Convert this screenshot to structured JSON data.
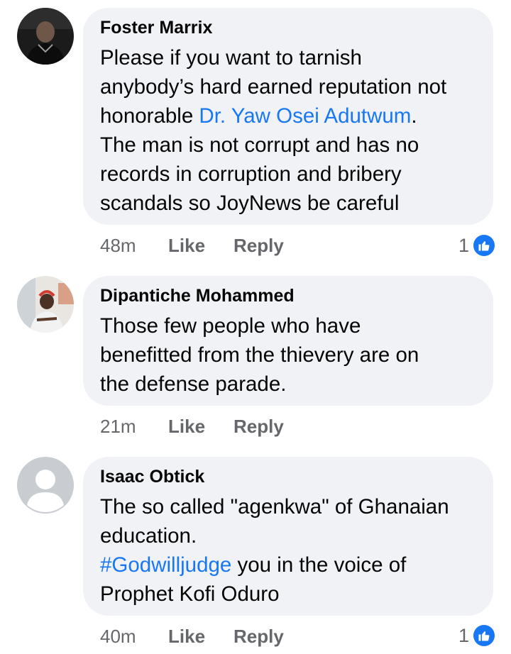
{
  "comments": [
    {
      "author": "Foster Marrix",
      "text_lines": [
        "Please if you want to tarnish",
        "anybody’s hard earned reputation not",
        "honorable ",
        "The man is not corrupt and has no",
        "records in corruption and bribery",
        "scandals so JoyNews be careful"
      ],
      "mention": "Dr. Yaw Osei Adutwum",
      "mention_suffix": ".",
      "time": "48m",
      "like_label": "Like",
      "reply_label": "Reply",
      "reaction_count": "1",
      "reaction_icon": "thumbs-up-icon"
    },
    {
      "author": "Dipantiche Mohammed",
      "text_lines": [
        "Those few people who have",
        "benefitted from the thievery are on",
        "the defense parade."
      ],
      "time": "21m",
      "like_label": "Like",
      "reply_label": "Reply"
    },
    {
      "author": "Isaac Obtick",
      "text_lines": [
        "The so called \"agenkwa\" of Ghanaian",
        "education.",
        " you in the voice of",
        "Prophet Kofi Oduro"
      ],
      "hashtag": "#Godwilljudge",
      "time": "40m",
      "like_label": "Like",
      "reply_label": "Reply",
      "reaction_count": "1",
      "reaction_icon": "thumbs-up-icon"
    }
  ],
  "colors": {
    "bubble": "#f0f2f5",
    "link": "#1877f2",
    "meta": "#65676b",
    "like_badge": "#1877f2"
  }
}
